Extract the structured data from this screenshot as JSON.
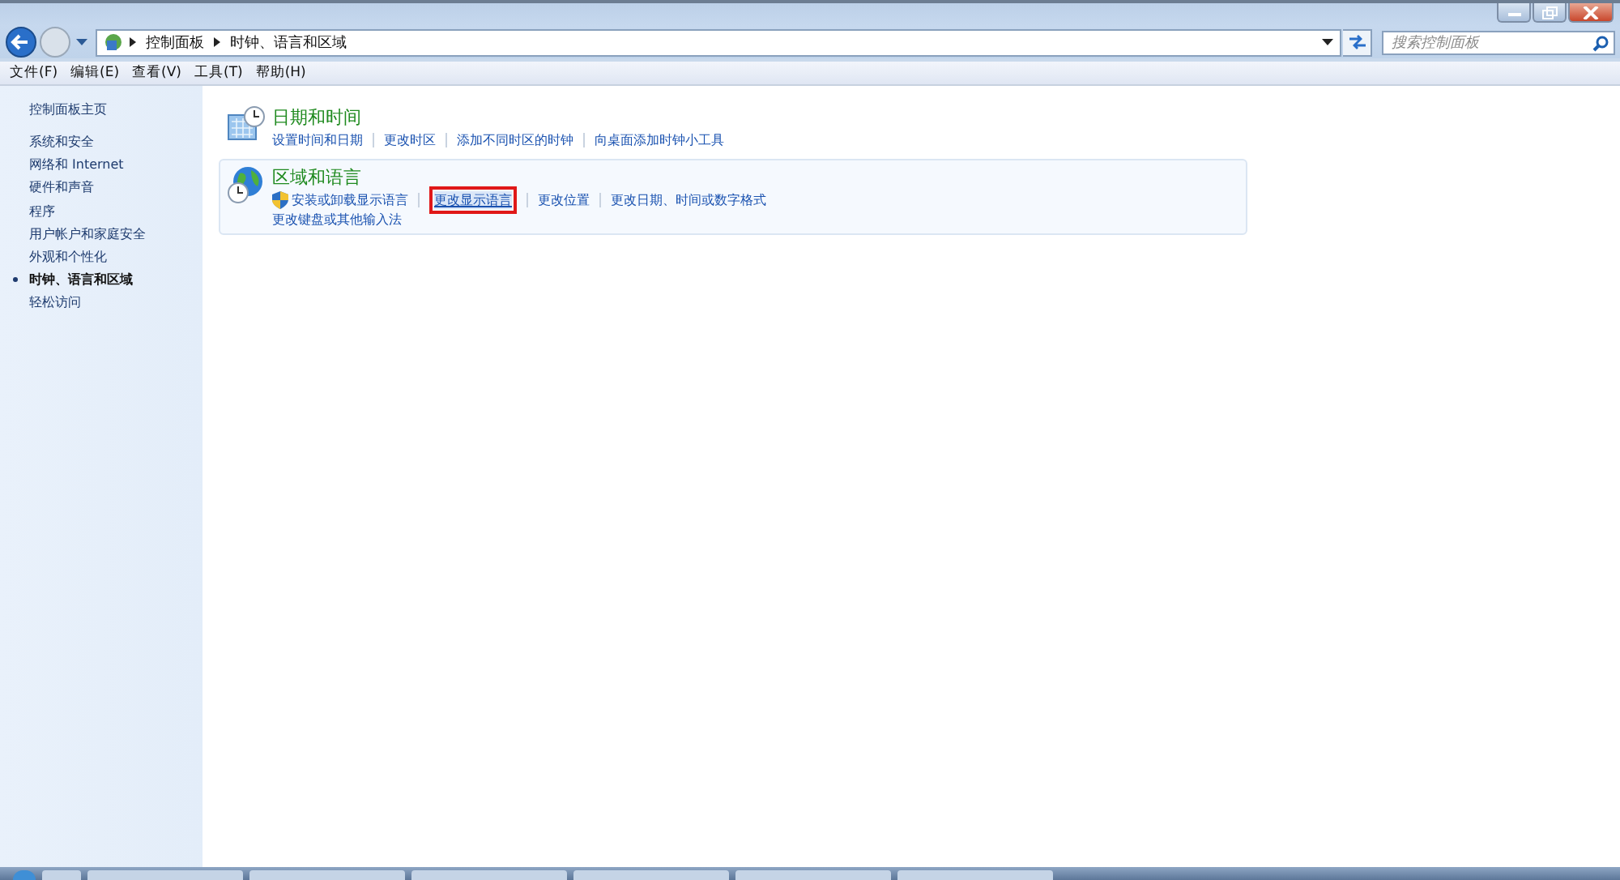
{
  "address_bar": {
    "crumbs": [
      "控制面板",
      "时钟、语言和区域"
    ]
  },
  "search": {
    "placeholder": "搜索控制面板"
  },
  "menu": [
    "文件(F)",
    "编辑(E)",
    "查看(V)",
    "工具(T)",
    "帮助(H)"
  ],
  "sidebar": {
    "home": "控制面板主页",
    "items": [
      {
        "label": "系统和安全",
        "selected": false
      },
      {
        "label": "网络和 Internet",
        "selected": false
      },
      {
        "label": "硬件和声音",
        "selected": false
      },
      {
        "label": "程序",
        "selected": false
      },
      {
        "label": "用户帐户和家庭安全",
        "selected": false
      },
      {
        "label": "外观和个性化",
        "selected": false
      },
      {
        "label": "时钟、语言和区域",
        "selected": true
      },
      {
        "label": "轻松访问",
        "selected": false
      }
    ]
  },
  "categories": [
    {
      "title": "日期和时间",
      "hovered": false,
      "link_rows": [
        [
          {
            "label": "设置时间和日期",
            "shield": false,
            "highlighted": false
          },
          {
            "label": "更改时区",
            "shield": false,
            "highlighted": false
          },
          {
            "label": "添加不同时区的时钟",
            "shield": false,
            "highlighted": false
          },
          {
            "label": "向桌面添加时钟小工具",
            "shield": false,
            "highlighted": false
          }
        ]
      ]
    },
    {
      "title": "区域和语言",
      "hovered": true,
      "link_rows": [
        [
          {
            "label": "安装或卸载显示语言",
            "shield": true,
            "highlighted": false
          },
          {
            "label": "更改显示语言",
            "shield": false,
            "highlighted": true
          },
          {
            "label": "更改位置",
            "shield": false,
            "highlighted": false
          },
          {
            "label": "更改日期、时间或数字格式",
            "shield": false,
            "highlighted": false
          }
        ],
        [
          {
            "label": "更改键盘或其他输入法",
            "shield": false,
            "highlighted": false
          }
        ]
      ]
    }
  ]
}
